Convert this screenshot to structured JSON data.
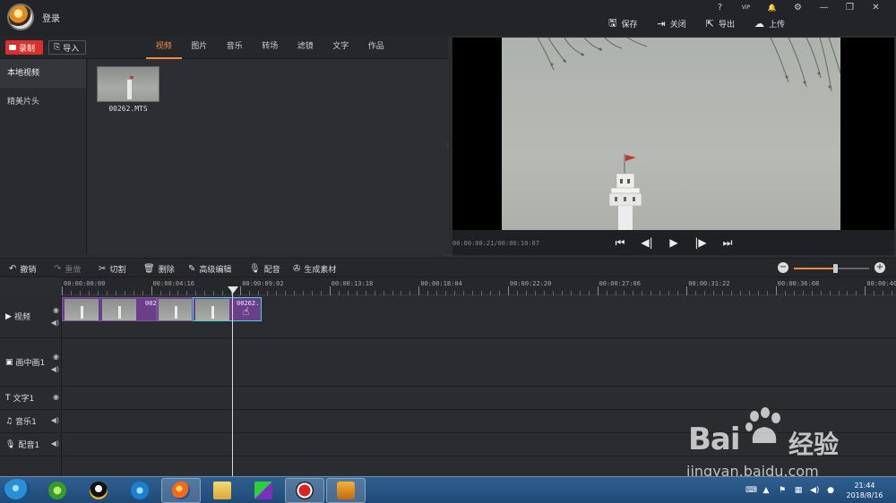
{
  "header": {
    "login": "登录",
    "actions": [
      {
        "label": "保存",
        "icon": "save-icon"
      },
      {
        "label": "关闭",
        "icon": "exit-icon"
      },
      {
        "label": "导出",
        "icon": "export-icon"
      },
      {
        "label": "上传",
        "icon": "upload-icon"
      }
    ],
    "window_controls": [
      "?",
      "VIP",
      "🔔",
      "⚙",
      "—",
      "❐",
      "✕"
    ]
  },
  "media": {
    "record_label": "录制",
    "import_label": "导入",
    "tabs": [
      "视频",
      "图片",
      "音乐",
      "转场",
      "滤镜",
      "文字",
      "作品"
    ],
    "active_tab": "视频",
    "side_items": [
      "本地视频",
      "精美片头"
    ],
    "clips": [
      {
        "name": "00262.MTS"
      }
    ]
  },
  "preview": {
    "time": "00:00:08:21/00:00:10:07"
  },
  "edit_toolbar": {
    "undo": "撤销",
    "redo": "重做",
    "cut": "切割",
    "delete": "删除",
    "advanced": "高级编辑",
    "dub": "配音",
    "generate": "生成素材",
    "zoom_level": 0.55
  },
  "timeline": {
    "ruler": [
      "00:00:00:00",
      "00:00:04:16",
      "00:00:09:02",
      "00:00:13:18",
      "00:00:18:04",
      "00:00:22:20",
      "00:00:27:06",
      "00:00:31:22",
      "00:00:36:08",
      "00:00:40:"
    ],
    "tracks": [
      {
        "label": "视频",
        "icon": "play-icon",
        "controls": [
          "eye-icon",
          "speaker-icon"
        ]
      },
      {
        "label": "画中画1",
        "icon": "pip-icon",
        "controls": [
          "eye-icon",
          "speaker-icon"
        ]
      },
      {
        "label": "文字1",
        "icon": "text-icon",
        "controls": [
          "eye-icon"
        ]
      },
      {
        "label": "音乐1",
        "icon": "music-icon",
        "controls": [
          "speaker-icon"
        ]
      },
      {
        "label": "配音1",
        "icon": "mic-icon",
        "controls": [
          "speaker-icon"
        ]
      }
    ],
    "clip_labels": [
      "002",
      "00262."
    ]
  },
  "taskbar": {
    "time": "21:44",
    "date": "2018/8/16"
  },
  "watermark": {
    "brand": "Bai",
    "brand_suffix": "经验",
    "url": "jingyan.baidu.com"
  }
}
